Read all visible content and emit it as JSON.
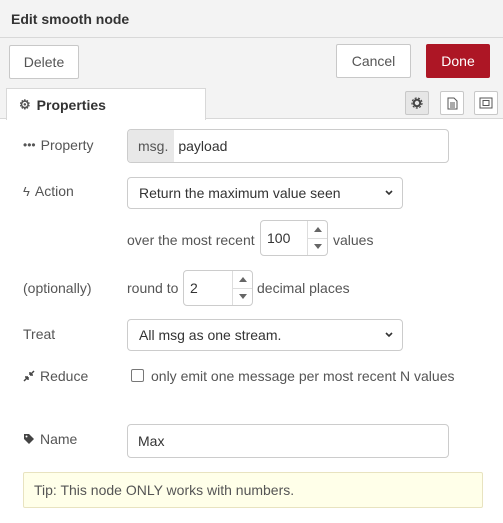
{
  "dialog": {
    "title": "Edit smooth node",
    "delete_label": "Delete",
    "cancel_label": "Cancel",
    "done_label": "Done"
  },
  "tabs": {
    "properties_label": "Properties"
  },
  "form": {
    "property": {
      "label": "Property",
      "prefix": "msg.",
      "value": "payload"
    },
    "action": {
      "label": "Action",
      "selected": "Return the maximum value seen"
    },
    "over": {
      "before": "over the most recent",
      "value": "100",
      "after": "values"
    },
    "round": {
      "label": "(optionally)",
      "before": "round to",
      "value": "2",
      "after": "decimal places"
    },
    "treat": {
      "label": "Treat",
      "selected": "All msg as one stream."
    },
    "reduce": {
      "label": "Reduce",
      "checkbox_label": "only emit one message per most recent N values",
      "checked": false
    },
    "name": {
      "label": "Name",
      "value": "Max"
    },
    "tip": "Tip: This node ONLY works with numbers."
  },
  "colors": {
    "accent": "#ad1625",
    "header_bg": "#f3f3f3",
    "tip_bg": "#ffffe9"
  }
}
